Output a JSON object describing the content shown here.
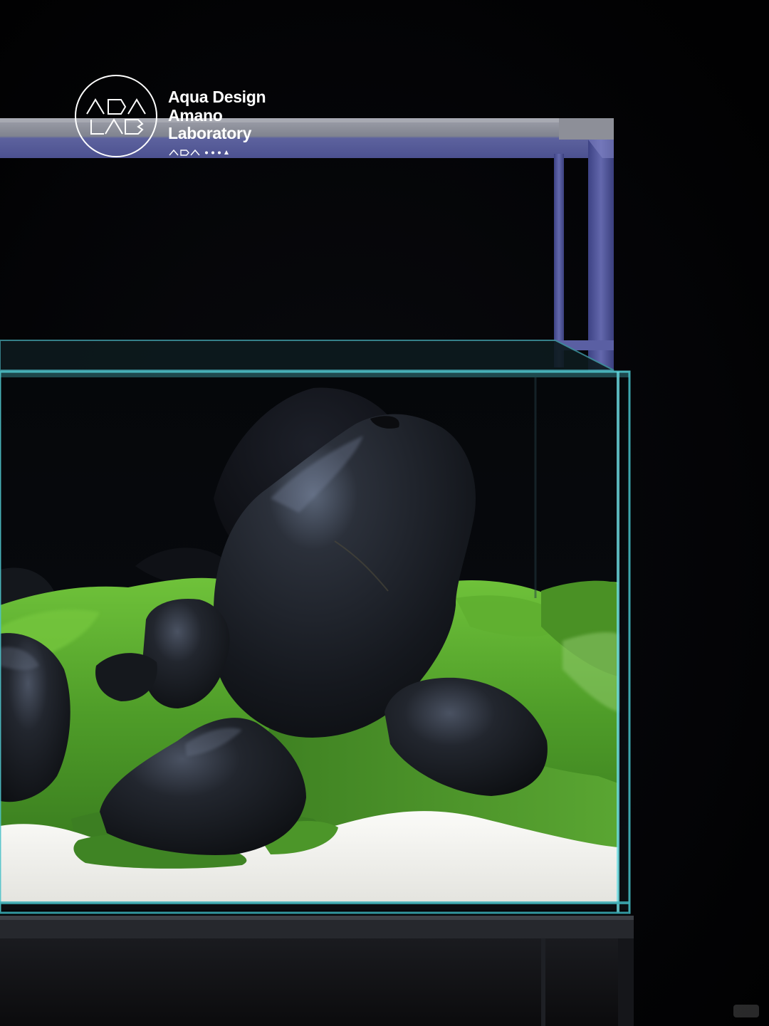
{
  "logo": {
    "line1": "Aqua Design",
    "line2": "Amano",
    "line3": "Laboratory",
    "emblem_icon": "ada-lab-circle-emblem",
    "sub_mark_icon": "ada-small-wordmark-with-dots"
  },
  "watermark": {
    "icon": "xiaohongshu-watermark"
  },
  "colors": {
    "background": "#020203",
    "lamp_frame": "#5b5f9c",
    "glass_edge": "#5fd0d6",
    "moss": "#56a82e",
    "sand": "#f1f1ee",
    "stone": "#1c1f26"
  }
}
